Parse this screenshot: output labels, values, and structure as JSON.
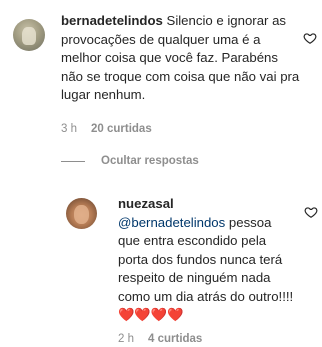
{
  "comments": [
    {
      "username": "bernadetelindos",
      "text": "Silencio e ignorar as provocações de qualquer uma é a melhor coisa que você faz. Parabéns não se troque com coisa que não vai pra lugar nenhum.",
      "time": "3 h",
      "likes": "20 curtidas"
    }
  ],
  "replies_toggle": {
    "label": "Ocultar respostas"
  },
  "replies": [
    {
      "username": "nuezasal",
      "mention": "@bernadetelindos",
      "text": "pessoa que entra escondido pela porta dos fundos nunca terá respeito de ninguém nada como um dia atrás do outro!!!! ❤️❤️❤️❤️",
      "time": "2 h",
      "likes": "4 curtidas"
    }
  ],
  "icons": {
    "like": "heart-outline-icon",
    "avatar": "user-avatar"
  },
  "colors": {
    "text": "#262626",
    "secondary": "#8e8e8e",
    "mention": "#00376b"
  }
}
